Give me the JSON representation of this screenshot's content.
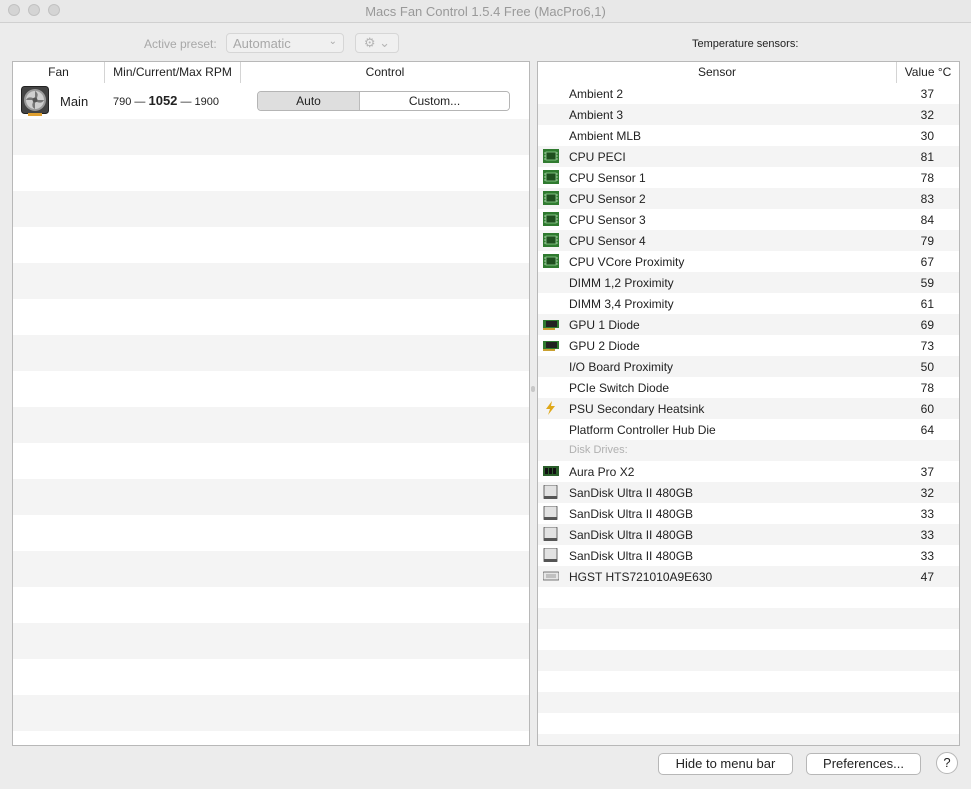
{
  "window": {
    "title": "Macs Fan Control 1.5.4 Free (MacPro6,1)"
  },
  "toolbar": {
    "preset_label": "Active preset:",
    "preset_value": "Automatic",
    "gear_icon": "gear-icon"
  },
  "fans": {
    "columns": [
      "Fan",
      "Min/Current/Max RPM",
      "Control"
    ],
    "rows": [
      {
        "name": "Main",
        "min": "790",
        "current": "1052",
        "max": "1900",
        "auto_label": "Auto",
        "custom_label": "Custom...",
        "icon": "fan-icon"
      }
    ]
  },
  "sensors": {
    "heading": "Temperature sensors:",
    "columns": [
      "Sensor",
      "Value °C"
    ],
    "rows": [
      {
        "icon": "",
        "name": "Ambient 2",
        "value": "37"
      },
      {
        "icon": "",
        "name": "Ambient 3",
        "value": "32"
      },
      {
        "icon": "",
        "name": "Ambient MLB",
        "value": "30"
      },
      {
        "icon": "cpu",
        "name": "CPU PECI",
        "value": "81"
      },
      {
        "icon": "cpu",
        "name": "CPU Sensor 1",
        "value": "78"
      },
      {
        "icon": "cpu",
        "name": "CPU Sensor 2",
        "value": "83"
      },
      {
        "icon": "cpu",
        "name": "CPU Sensor 3",
        "value": "84"
      },
      {
        "icon": "cpu",
        "name": "CPU Sensor 4",
        "value": "79"
      },
      {
        "icon": "cpu",
        "name": "CPU VCore Proximity",
        "value": "67"
      },
      {
        "icon": "",
        "name": "DIMM 1,2 Proximity",
        "value": "59"
      },
      {
        "icon": "",
        "name": "DIMM 3,4 Proximity",
        "value": "61"
      },
      {
        "icon": "gpu",
        "name": "GPU 1 Diode",
        "value": "69"
      },
      {
        "icon": "gpu",
        "name": "GPU 2 Diode",
        "value": "73"
      },
      {
        "icon": "",
        "name": "I/O Board Proximity",
        "value": "50"
      },
      {
        "icon": "",
        "name": "PCIe Switch Diode",
        "value": "78"
      },
      {
        "icon": "power",
        "name": "PSU Secondary Heatsink",
        "value": "60"
      },
      {
        "icon": "",
        "name": "Platform Controller Hub Die",
        "value": "64"
      },
      {
        "section": true,
        "name": "Disk Drives:",
        "value": ""
      },
      {
        "icon": "ssd",
        "name": "Aura Pro X2",
        "value": "37"
      },
      {
        "icon": "disk",
        "name": "SanDisk Ultra II 480GB",
        "value": "32"
      },
      {
        "icon": "disk",
        "name": "SanDisk Ultra II 480GB",
        "value": "33"
      },
      {
        "icon": "disk",
        "name": "SanDisk Ultra II 480GB",
        "value": "33"
      },
      {
        "icon": "disk",
        "name": "SanDisk Ultra II 480GB",
        "value": "33"
      },
      {
        "icon": "hdd",
        "name": "HGST HTS721010A9E630",
        "value": "47"
      }
    ]
  },
  "footer": {
    "hide_label": "Hide to menu bar",
    "prefs_label": "Preferences...",
    "help_label": "?"
  }
}
